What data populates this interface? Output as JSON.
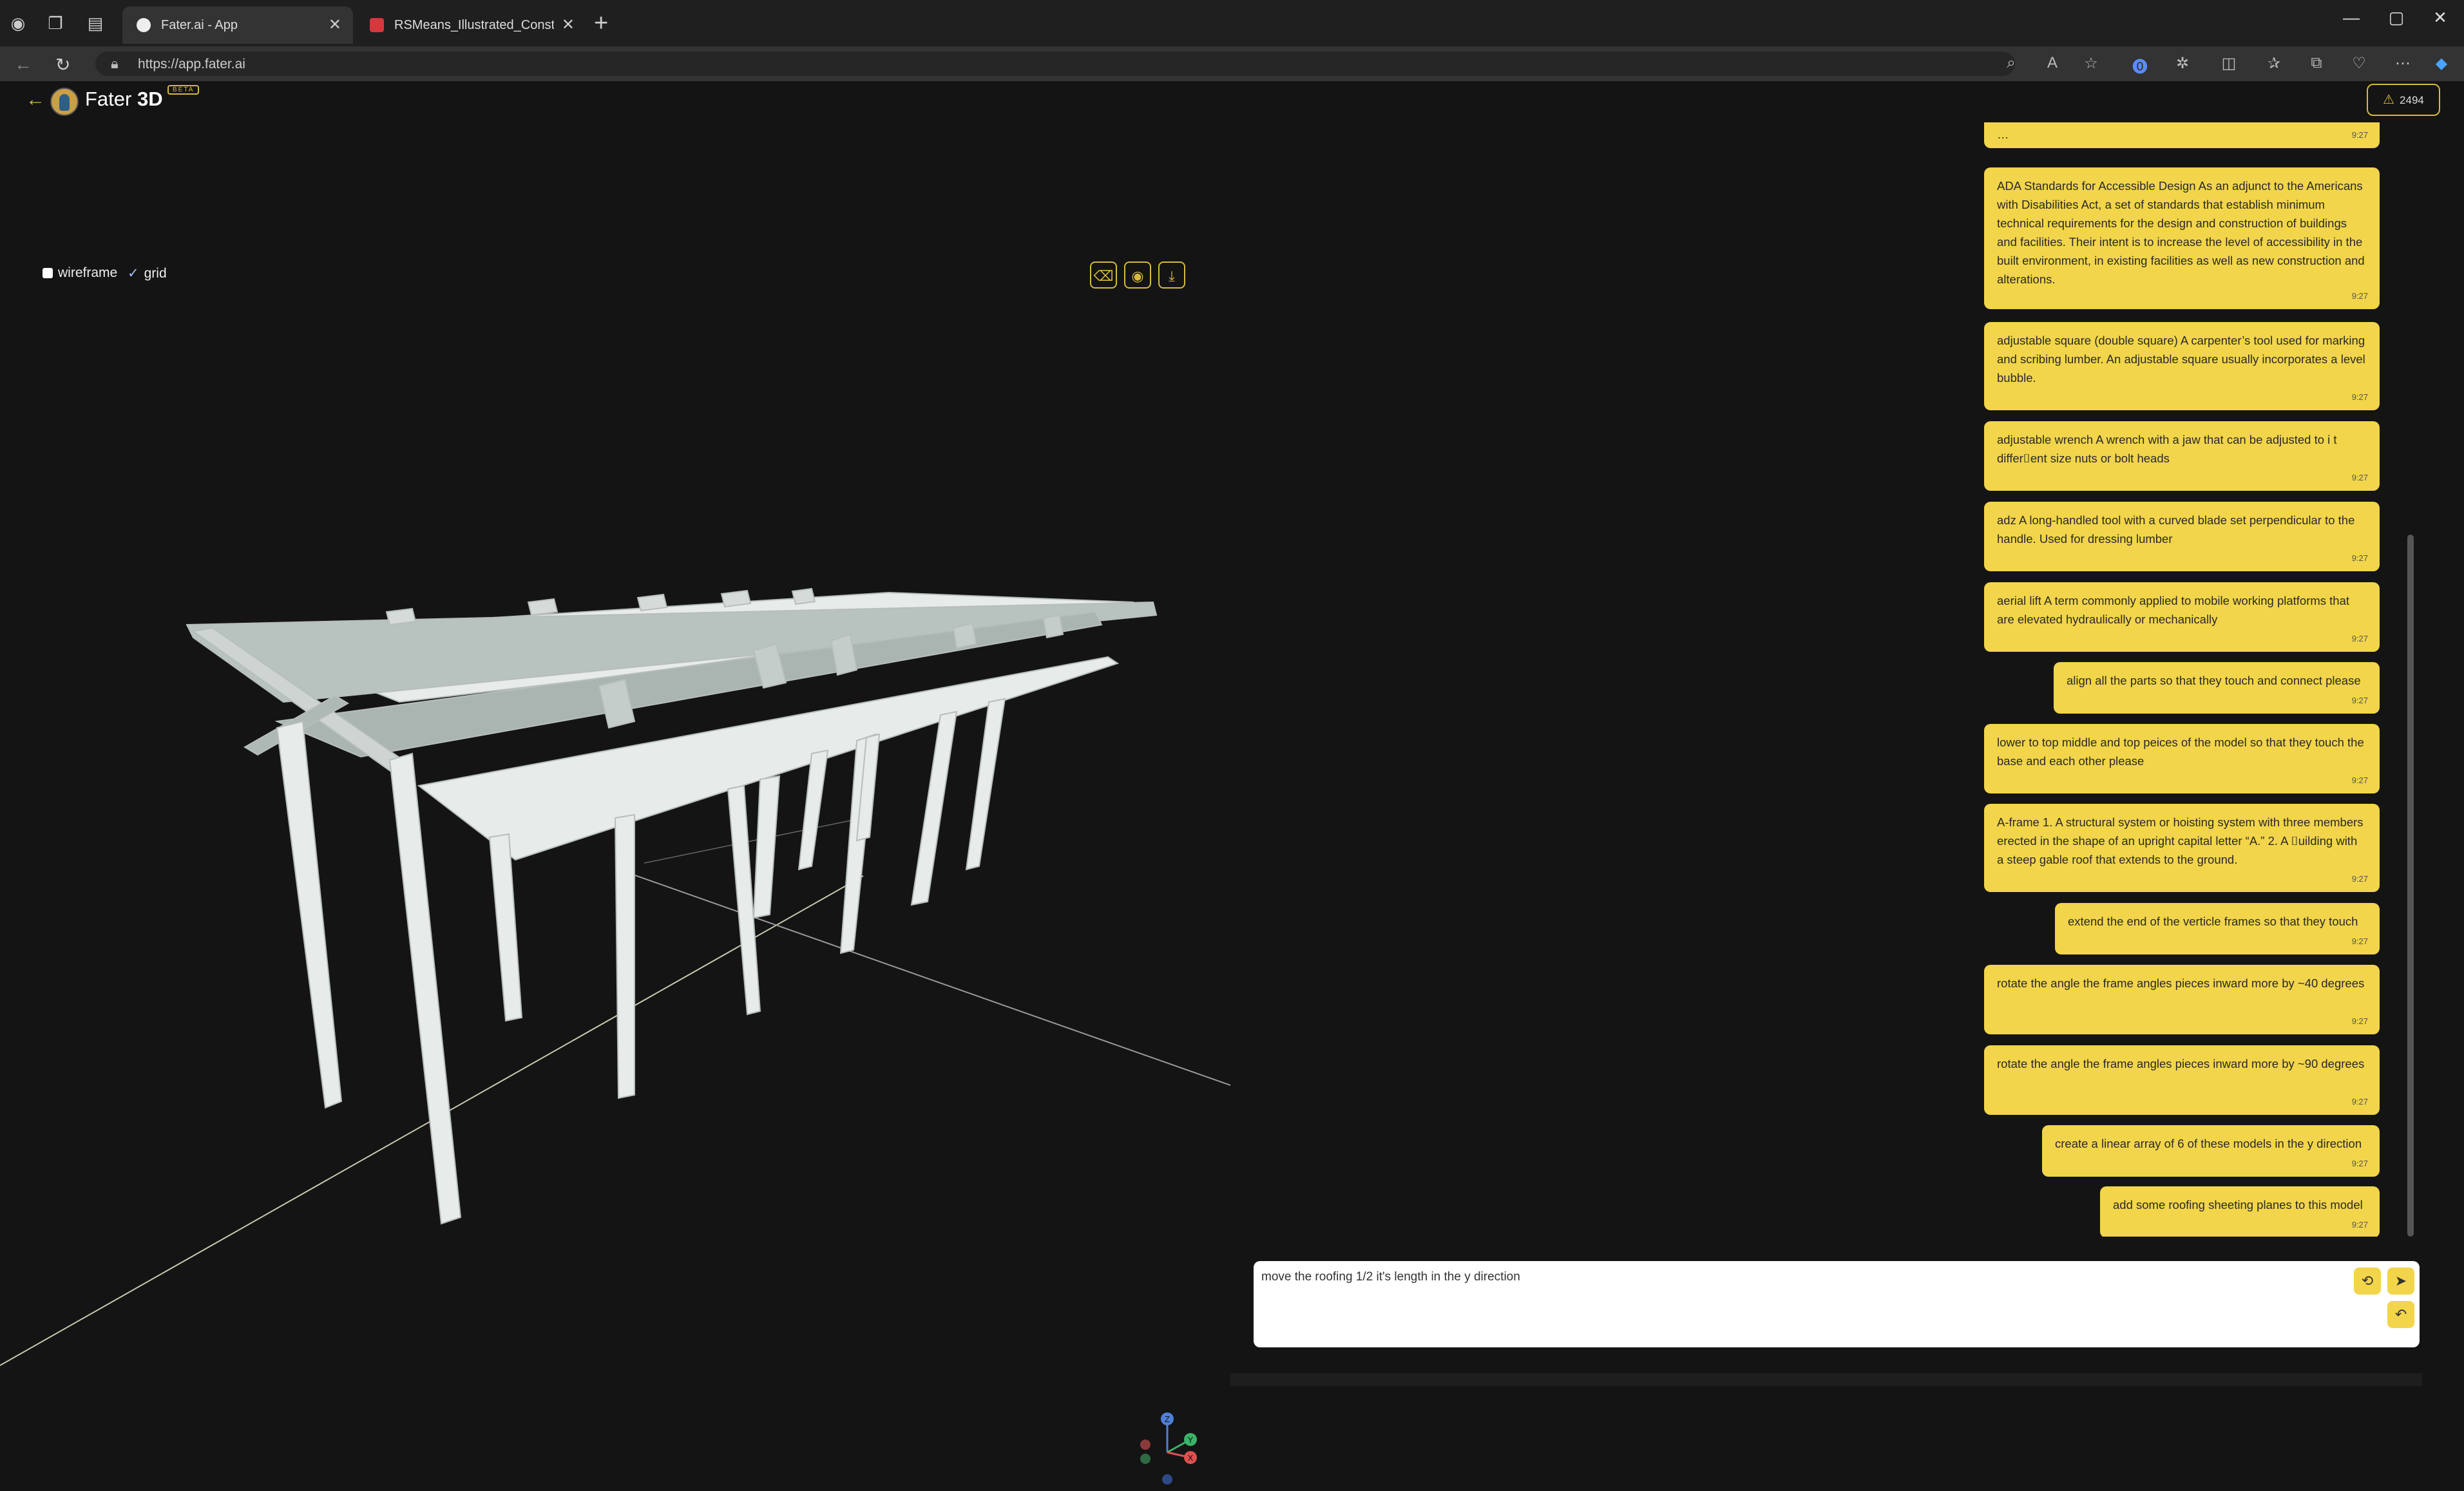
{
  "browser": {
    "tabs": [
      {
        "title": "Fater.ai - App",
        "active": true
      },
      {
        "title": "RSMeans_Illustrated_Constructio",
        "active": false
      }
    ],
    "url": "https://app.fater.ai"
  },
  "app": {
    "brand_name": "Fater",
    "brand_suffix": "3D",
    "beta_label": "BETA",
    "credits": "2494"
  },
  "viewport": {
    "wireframe_label": "wireframe",
    "grid_label": "grid",
    "wireframe_checked": false,
    "grid_checked": true,
    "axis_labels": {
      "z": "Z",
      "y": "Y",
      "x": "X"
    }
  },
  "chat": {
    "messages": [
      {
        "text": "…",
        "time": "9:27",
        "partial": true
      },
      {
        "text": "ADA Standards for Accessible Design As an adjunct to the Americans with Disabilities Act, a set of standards that establish minimum technical requirements for the design and construction of buildings and facilities. Their intent is to increase the level of accessibility in the built environment, in existing facilities as well as new construction and alterations.",
        "time": "9:27"
      },
      {
        "text": "adjustable square (double square) A carpenter’s tool used for marking and scribing lumber. An adjustable square usually incorporates a level bubble.",
        "time": "9:27"
      },
      {
        "text": "adjustable wrench A wrench with a jaw that can be adjusted to i t differ⌷ent size nuts or bolt heads",
        "time": "9:27"
      },
      {
        "text": "adz A long-handled tool with a curved blade set perpendicular to the handle. Used for dressing lumber",
        "time": "9:27"
      },
      {
        "text": "aerial lift A term commonly applied to mobile working platforms that are elevated hydraulically or mechanically",
        "time": "9:27"
      },
      {
        "text": "align all the parts so that they touch and connect please",
        "time": "9:27"
      },
      {
        "text": "lower to top middle and top peices of the model so that they touch the base and each other please",
        "time": "9:27"
      },
      {
        "text": "A-frame 1. A structural system or hoisting system with three members erected in the shape of an upright capital letter “A.” 2. A ⌷uilding with a steep gable roof that extends to the ground.",
        "time": "9:27"
      },
      {
        "text": "extend the end of the verticle frames so that they touch",
        "time": "9:27"
      },
      {
        "text": "rotate the angle the frame angles pieces inward more by ~40 degrees",
        "time": "9:27"
      },
      {
        "text": "rotate the angle the frame angles pieces inward more by ~90 degrees",
        "time": "9:27"
      },
      {
        "text": "create a linear array of 6 of these models in the y direction",
        "time": "9:27"
      },
      {
        "text": "add some roofing sheeting planes to this model",
        "time": "9:27"
      }
    ],
    "input_value": "move the roofing 1/2 it's length in the y direction"
  },
  "icons": {
    "back": "arrow-left-icon",
    "eraser": "eraser-icon",
    "camera": "camera-icon",
    "download": "download-icon",
    "warning": "warning-icon",
    "refresh": "refresh-icon",
    "send": "send-icon",
    "undo": "undo-icon"
  },
  "colors": {
    "accent": "#f2d54a",
    "background": "#141414",
    "model": "#e8ebe9"
  }
}
